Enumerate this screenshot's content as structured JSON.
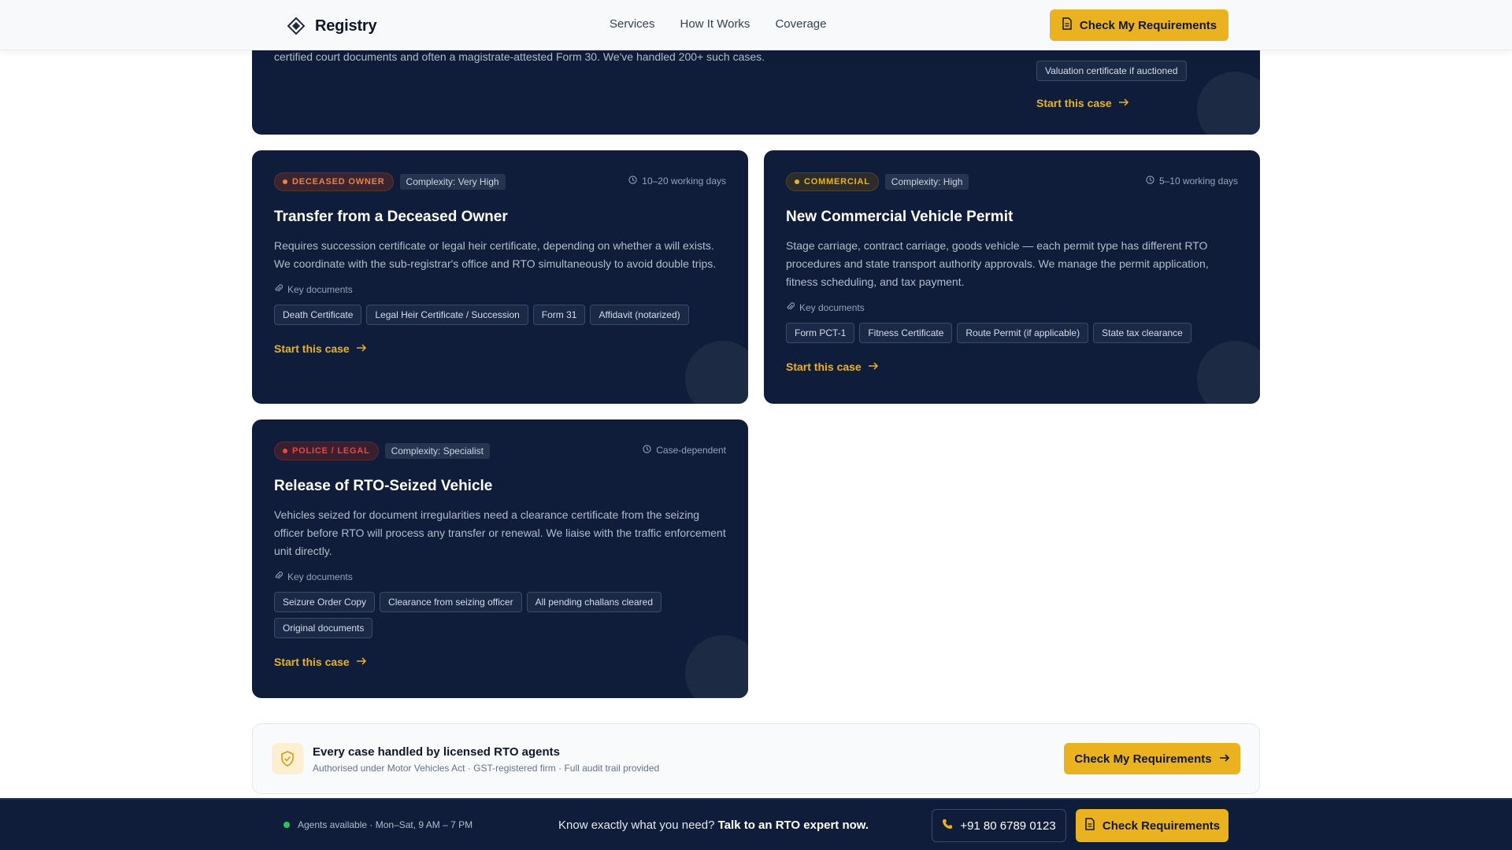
{
  "header": {
    "brand": "Registry",
    "nav": [
      "Services",
      "How It Works",
      "Coverage"
    ],
    "cta_label": "Check My Requirements"
  },
  "top_card": {
    "description_tail": "certified court documents and often a magistrate-attested Form 30. We've handled 200+ such cases.",
    "doc_chip": "Valuation certificate if auctioned",
    "link_label": "Start this case"
  },
  "cards": [
    {
      "badge": "DECEASED OWNER",
      "complexity": "Complexity: Very High",
      "time": "10–20 working days",
      "title": "Transfer from a Deceased Owner",
      "description": "Requires succession certificate or legal heir certificate, depending on whether a will exists. We coordinate with the sub-registrar's office and RTO simultaneously to avoid double trips.",
      "key_docs_label": "Key documents",
      "docs": [
        "Death Certificate",
        "Legal Heir Certificate / Succession",
        "Form 31",
        "Affidavit (notarized)"
      ],
      "link_label": "Start this case"
    },
    {
      "badge": "COMMERCIAL",
      "complexity": "Complexity: High",
      "time": "5–10 working days",
      "title": "New Commercial Vehicle Permit",
      "description": "Stage carriage, contract carriage, goods vehicle — each permit type has different RTO procedures and state transport authority approvals. We manage the permit application, fitness scheduling, and tax payment.",
      "key_docs_label": "Key documents",
      "docs": [
        "Form PCT-1",
        "Fitness Certificate",
        "Route Permit (if applicable)",
        "State tax clearance"
      ],
      "link_label": "Start this case"
    },
    {
      "badge": "POLICE / LEGAL",
      "complexity": "Complexity: Specialist",
      "time": "Case-dependent",
      "title": "Release of RTO-Seized Vehicle",
      "description": "Vehicles seized for document irregularities need a clearance certificate from the seizing officer before RTO will process any transfer or renewal. We liaise with the traffic enforcement unit directly.",
      "key_docs_label": "Key documents",
      "docs": [
        "Seizure Order Copy",
        "Clearance from seizing officer",
        "All pending challans cleared",
        "Original documents"
      ],
      "link_label": "Start this case"
    }
  ],
  "trust": {
    "title": "Every case handled by licensed RTO agents",
    "subtitle": "Authorised under Motor Vehicles Act · GST-registered firm · Full audit trail provided",
    "cta_label": "Check My Requirements"
  },
  "bottom_bar": {
    "availability": "Agents available · Mon–Sat, 9 AM – 7 PM",
    "prompt": "Know exactly what you need?",
    "prompt_bold": "Talk to an RTO expert now.",
    "phone": "+91 80 6789 0123",
    "cta_label": "Check Requirements"
  },
  "colors": {
    "accent": "#eab221",
    "card_bg": "#0f1d3a",
    "available": "#22c55e"
  }
}
